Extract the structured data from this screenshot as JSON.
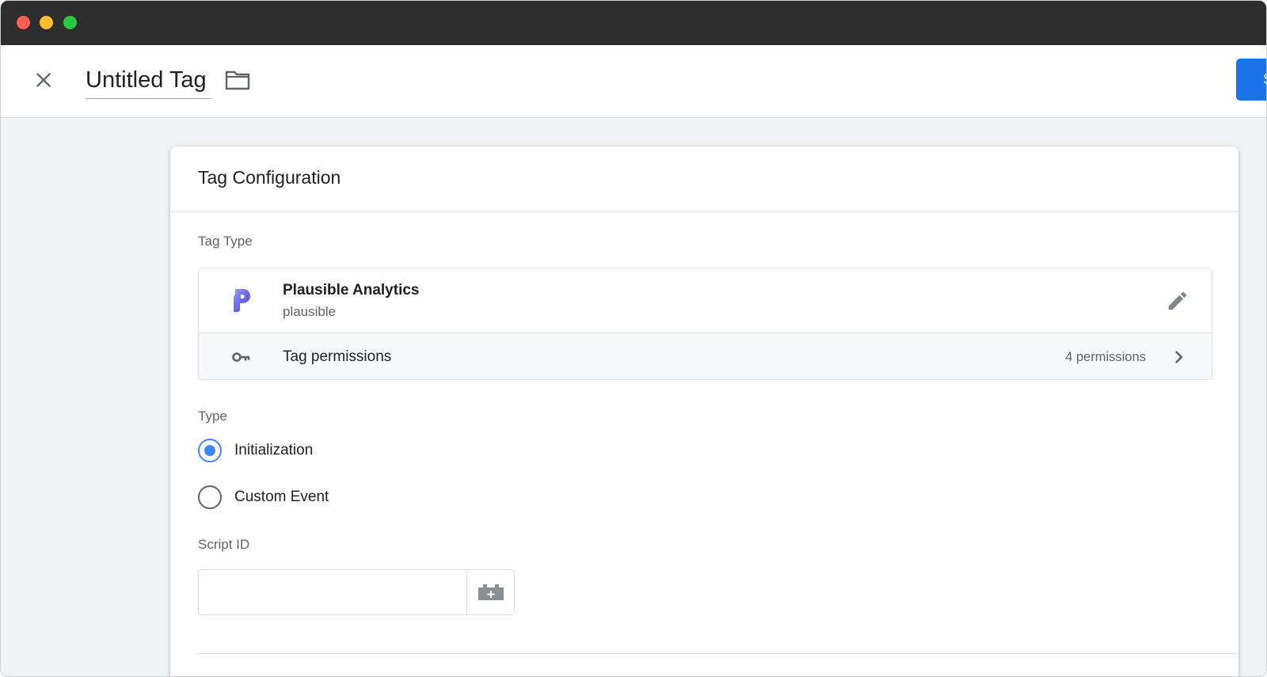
{
  "header": {
    "title": "Untitled Tag",
    "save_label": "S"
  },
  "card": {
    "title": "Tag Configuration",
    "tag_type_label": "Tag Type",
    "tag_type": {
      "name": "Plausible Analytics",
      "id": "plausible"
    },
    "permissions": {
      "label": "Tag permissions",
      "count": "4 permissions"
    },
    "type_label": "Type",
    "type_options": [
      {
        "label": "Initialization",
        "checked": true
      },
      {
        "label": "Custom Event",
        "checked": false
      }
    ],
    "script_id_label": "Script ID",
    "script_id_value": ""
  },
  "icons": [
    "close-icon",
    "folder-icon",
    "plausible-logo",
    "pencil-icon",
    "key-icon",
    "chevron-right-icon",
    "add-variable-icon"
  ],
  "colors": {
    "accent": "#1a73e8",
    "radio": "#4285f4",
    "plausible": "#5850ec"
  }
}
